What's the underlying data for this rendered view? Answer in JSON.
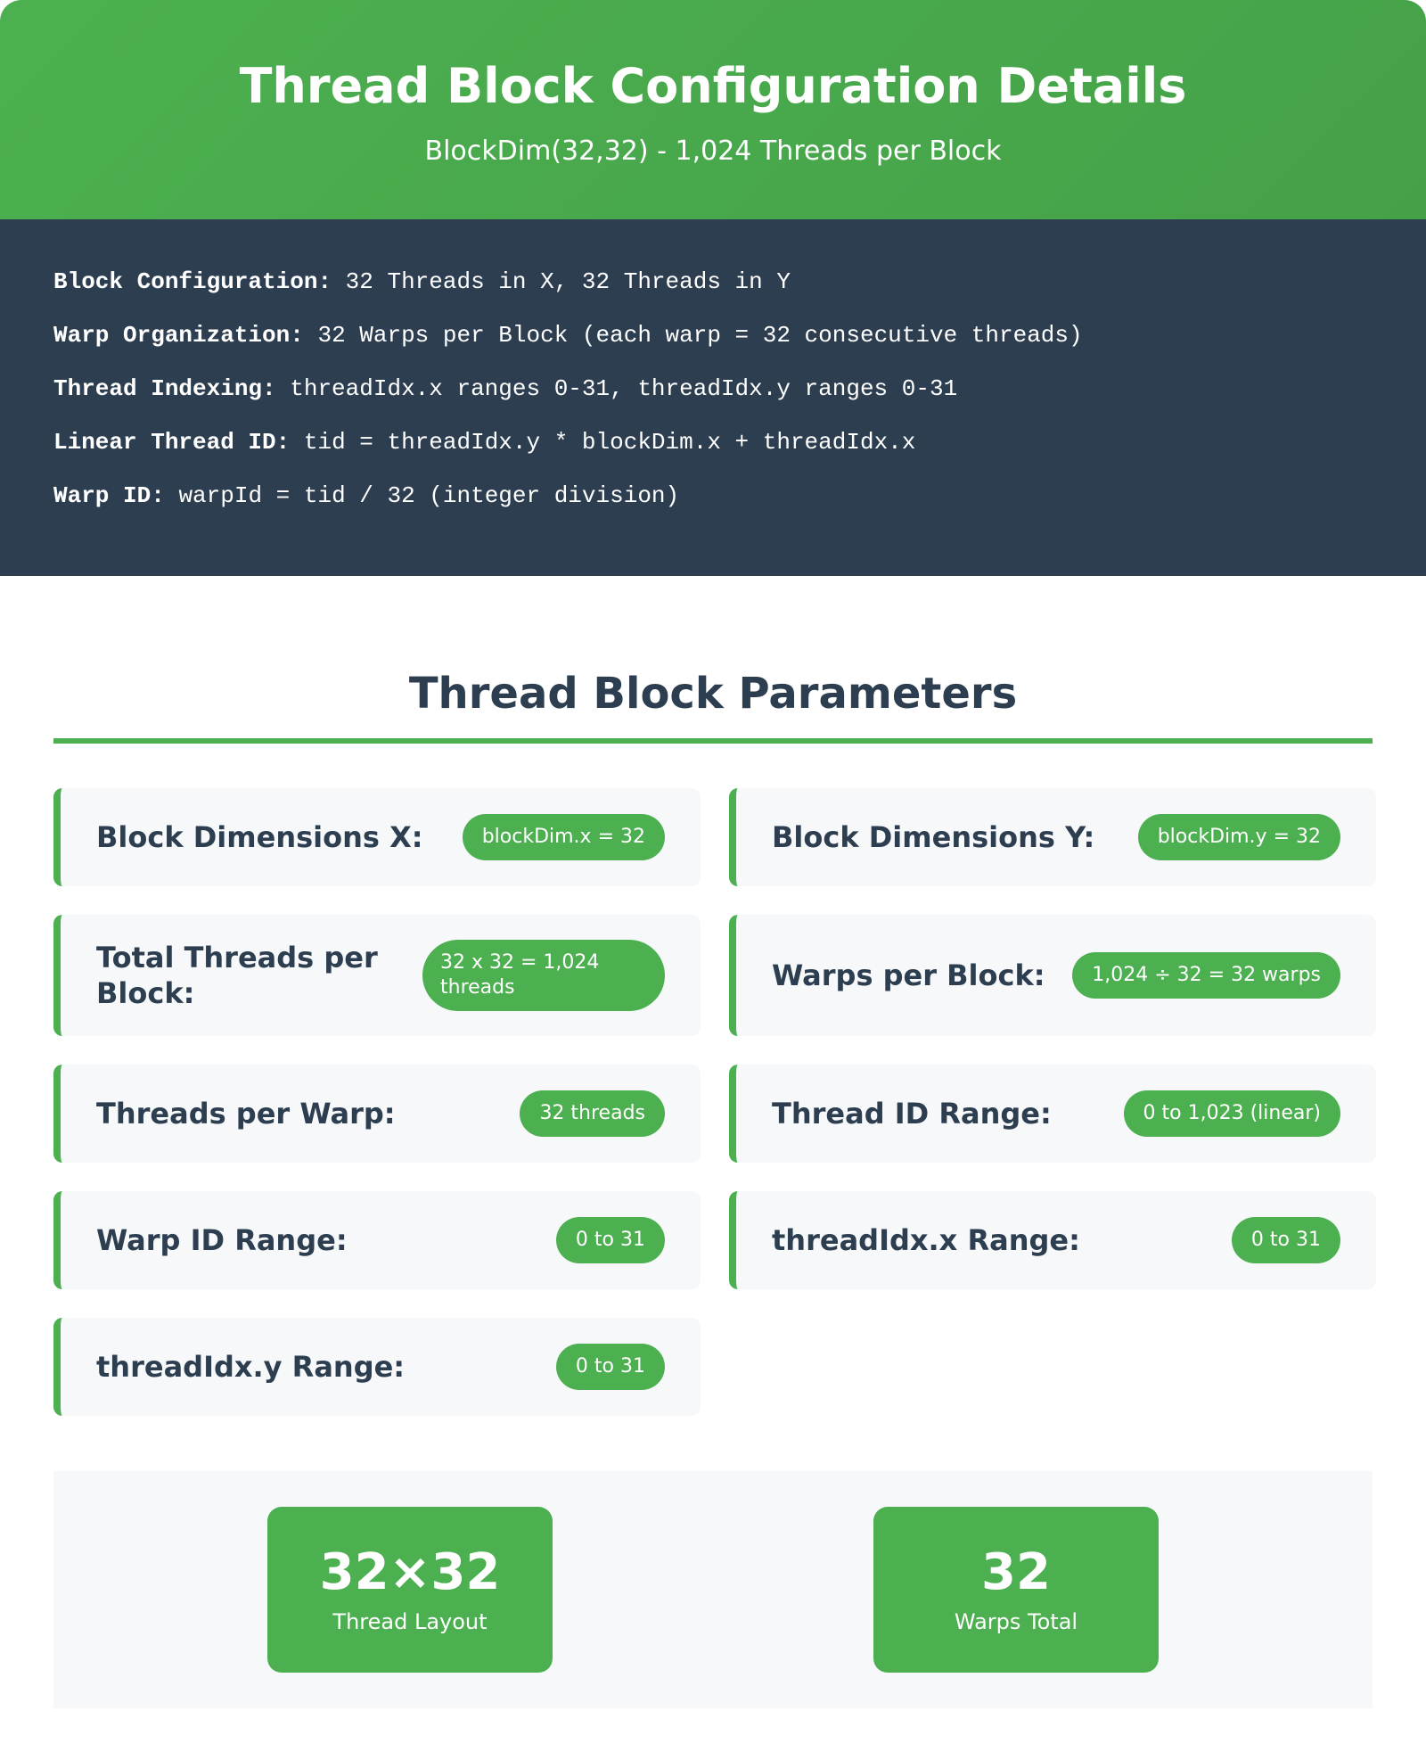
{
  "header": {
    "title": "Thread Block Configuration Details",
    "subtitle": "BlockDim(32,32) - 1,024 Threads per Block"
  },
  "config": [
    {
      "key": "Block Configuration:",
      "value": "32 Threads in X, 32 Threads in Y"
    },
    {
      "key": "Warp Organization:",
      "value": "32 Warps per Block (each warp = 32 consecutive threads)"
    },
    {
      "key": "Thread Indexing:",
      "value": "threadIdx.x ranges 0-31, threadIdx.y ranges 0-31"
    },
    {
      "key": "Linear Thread ID:",
      "value": "tid = threadIdx.y * blockDim.x + threadIdx.x"
    },
    {
      "key": "Warp ID:",
      "value": "warpId = tid / 32 (integer division)"
    }
  ],
  "parameters": {
    "title": "Thread Block Parameters",
    "items": [
      {
        "label": "Block Dimensions X:",
        "value": "blockDim.x = 32"
      },
      {
        "label": "Block Dimensions Y:",
        "value": "blockDim.y = 32"
      },
      {
        "label": "Total Threads per Block:",
        "value": "32 x 32 = 1,024 threads"
      },
      {
        "label": "Warps per Block:",
        "value": "1,024 ÷ 32 = 32 warps"
      },
      {
        "label": "Threads per Warp:",
        "value": "32 threads"
      },
      {
        "label": "Thread ID Range:",
        "value": "0 to 1,023 (linear)"
      },
      {
        "label": "Warp ID Range:",
        "value": "0 to 31"
      },
      {
        "label": "threadIdx.x Range:",
        "value": "0 to 31"
      },
      {
        "label": "threadIdx.y Range:",
        "value": "0 to 31"
      }
    ]
  },
  "summary": [
    {
      "number": "32×32",
      "caption": "Thread Layout"
    },
    {
      "number": "32",
      "caption": "Warps Total"
    }
  ],
  "colors": {
    "accent": "#4cb050",
    "dark": "#2d3e50",
    "card_bg": "#f6f8fa",
    "text": "#2c3e50"
  }
}
